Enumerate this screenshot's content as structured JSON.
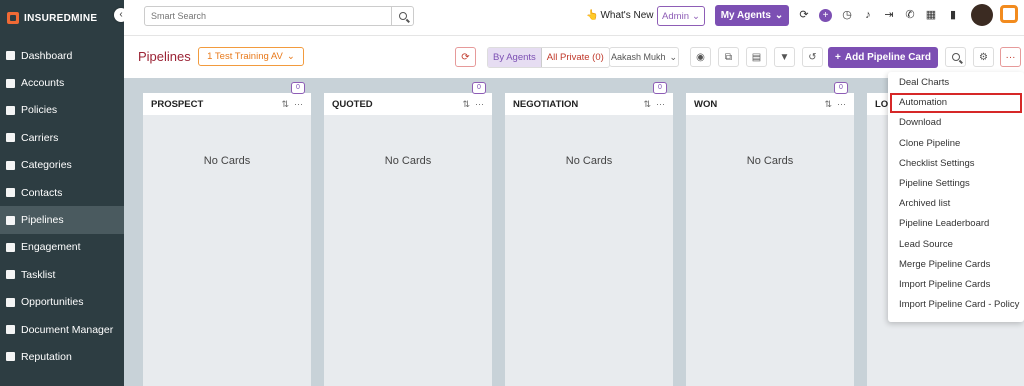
{
  "brand": {
    "name": "INSUREDMINE",
    "collapse_glyph": "‹"
  },
  "sidebar": {
    "items": [
      {
        "label": "Dashboard",
        "icon": "dashboard-icon",
        "active": false
      },
      {
        "label": "Accounts",
        "icon": "accounts-icon",
        "active": false
      },
      {
        "label": "Policies",
        "icon": "policies-icon",
        "active": false
      },
      {
        "label": "Carriers",
        "icon": "carriers-icon",
        "active": false
      },
      {
        "label": "Categories",
        "icon": "categories-icon",
        "active": false
      },
      {
        "label": "Contacts",
        "icon": "contacts-icon",
        "active": false
      },
      {
        "label": "Pipelines",
        "icon": "pipelines-icon",
        "active": true
      },
      {
        "label": "Engagement",
        "icon": "engagement-icon",
        "active": false
      },
      {
        "label": "Tasklist",
        "icon": "tasklist-icon",
        "active": false
      },
      {
        "label": "Opportunities",
        "icon": "opportunities-icon",
        "active": false
      },
      {
        "label": "Document Manager",
        "icon": "folder-icon",
        "active": false
      },
      {
        "label": "Reputation",
        "icon": "reputation-icon",
        "active": false
      }
    ]
  },
  "topbar": {
    "search_placeholder": "Smart Search",
    "whats_new": "What's New",
    "whats_new_icon": "👆",
    "admin": "Admin",
    "my_agents": "My Agents",
    "chevron": "⌄"
  },
  "toolbar": {
    "title": "Pipelines",
    "pipeline_selected": "1 Test Training AV",
    "by_agents": "By Agents",
    "all_private": "All Private (0)",
    "agent_selected": "Aakash Mukh",
    "add_card": "Add Pipeline Card",
    "add_card_icon": "+",
    "more": "···"
  },
  "columns": [
    {
      "title": "PROSPECT",
      "count": "0",
      "empty": "No Cards"
    },
    {
      "title": "QUOTED",
      "count": "0",
      "empty": "No Cards"
    },
    {
      "title": "NEGOTIATION",
      "count": "0",
      "empty": "No Cards"
    },
    {
      "title": "WON",
      "count": "0",
      "empty": "No Cards"
    },
    {
      "title": "LO",
      "count": "0",
      "empty": ""
    }
  ],
  "column_tools": {
    "sort": "⇅",
    "more": "···"
  },
  "dropdown": {
    "items": [
      "Deal Charts",
      "Automation",
      "Download",
      "Clone Pipeline",
      "Checklist Settings",
      "Pipeline Settings",
      "Archived list",
      "Pipeline Leaderboard",
      "Lead Source",
      "Merge Pipeline Cards",
      "Import Pipeline Cards",
      "Import Pipeline Card - Policy"
    ],
    "highlighted_index": 1,
    "highlight_color": "#d62828"
  },
  "colors": {
    "sidebar_bg": "#2d3d42",
    "accent_purple": "#7c4fb3",
    "title_red": "#9b2335",
    "orange": "#f29b3e",
    "board_bg": "#c8d2d8"
  }
}
